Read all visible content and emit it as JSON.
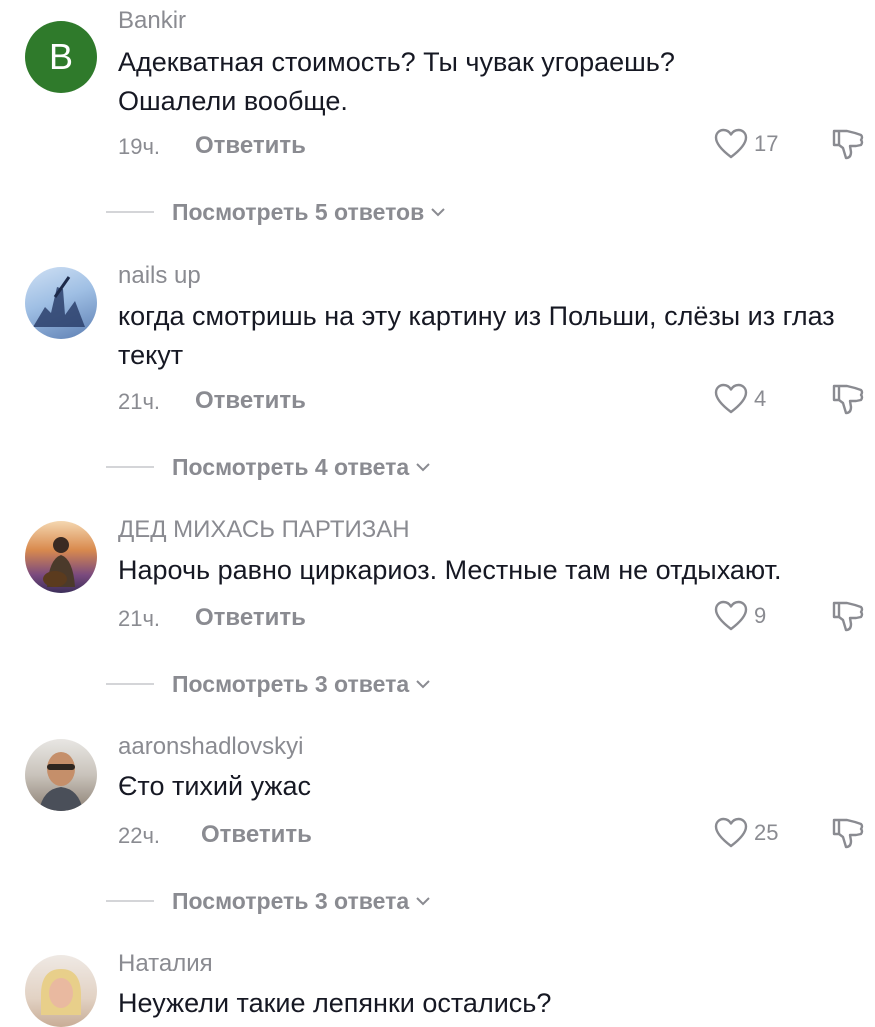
{
  "comments": [
    {
      "avatar_letter": "B",
      "avatar_color": "#2f7a2b",
      "username": "Bankir",
      "text": "Адекватная стоимость? Ты чувак угораешь? Ошалели вообще.",
      "time": "19ч.",
      "reply_label": "Ответить",
      "likes": "17",
      "view_replies": "Посмотреть 5 ответов"
    },
    {
      "username": "nails up",
      "text": "когда смотришь на эту картину из Польши, слёзы из глаз текут",
      "time": "21ч.",
      "reply_label": "Ответить",
      "likes": "4",
      "view_replies": "Посмотреть 4 ответа"
    },
    {
      "username": "ДЕД МИХАСЬ ПАРТИЗАН",
      "text": "Нарочь равно циркариоз. Местные там не отдыхают.",
      "time": "21ч.",
      "reply_label": "Ответить",
      "likes": "9",
      "view_replies": "Посмотреть 3 ответа"
    },
    {
      "username": "aaronshadlovskyi",
      "text": "Єто тихий ужас",
      "time": "22ч.",
      "reply_label": "Ответить",
      "likes": "25",
      "view_replies": "Посмотреть 3 ответа"
    },
    {
      "username": "Наталия",
      "text": "Неужели такие лепянки остались?"
    }
  ],
  "colors": {
    "text": "#161823",
    "secondary": "#8a8b91",
    "divider": "#d4d5d8"
  },
  "icons": [
    "heart-icon",
    "dislike-icon",
    "chevron-down-icon"
  ]
}
